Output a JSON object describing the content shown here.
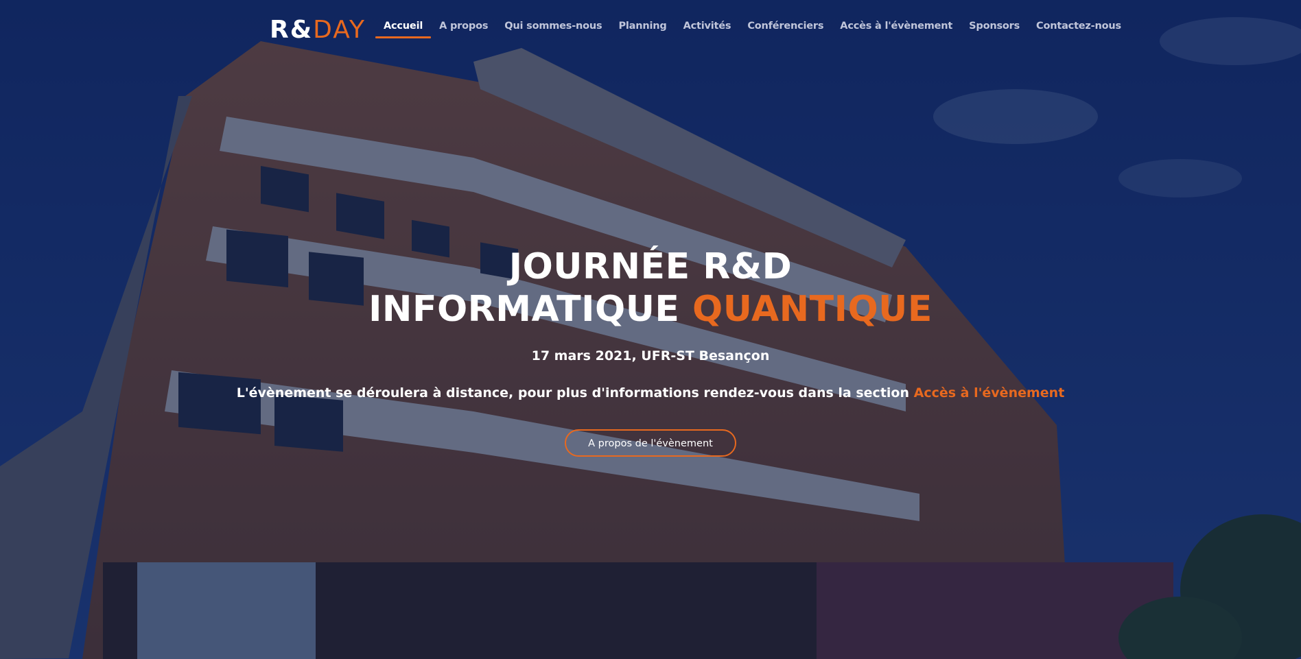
{
  "colors": {
    "accent": "#e8691f",
    "overlay": "#0a163c",
    "text": "#ffffff"
  },
  "logo": {
    "part1": "R&",
    "part2": "DAY"
  },
  "nav": {
    "items": [
      {
        "label": "Accueil",
        "active": true
      },
      {
        "label": "A propos"
      },
      {
        "label": "Qui sommes-nous"
      },
      {
        "label": "Planning"
      },
      {
        "label": "Activités"
      },
      {
        "label": "Conférenciers"
      },
      {
        "label": "Accès à l'évènement"
      },
      {
        "label": "Sponsors"
      },
      {
        "label": "Contactez-nous"
      }
    ]
  },
  "hero": {
    "title_line1": "JOURNÉE R&D",
    "title_line2_white": "INFORMATIQUE ",
    "title_line2_accent": "QUANTIQUE",
    "date_location": "17 mars 2021, UFR-ST Besançon",
    "notice_text": "L'évènement se déroulera à distance, pour plus d'informations rendez-vous dans la section ",
    "notice_link": "Accès à l'évènement",
    "cta_label": "A propos de l'évènement"
  }
}
